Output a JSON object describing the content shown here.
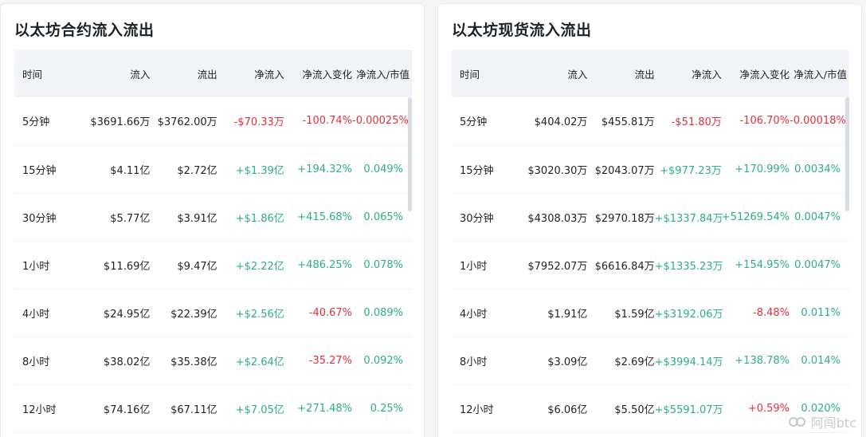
{
  "left_panel": {
    "title": "以太坊合约流入流出",
    "headers": [
      "时间",
      "流入",
      "流出",
      "净流入",
      "净流入变化",
      "净流入/市值"
    ],
    "rows": [
      {
        "time": "5分钟",
        "inflow": "$3691.66万",
        "outflow": "$3762.00万",
        "net": "-$70.33万",
        "change": "-100.74%",
        "ratio": "-0.00025%",
        "net_dir": "neg",
        "change_dir": "neg",
        "ratio_dir": "neg"
      },
      {
        "time": "15分钟",
        "inflow": "$4.11亿",
        "outflow": "$2.72亿",
        "net": "+$1.39亿",
        "change": "+194.32%",
        "ratio": "0.049%",
        "net_dir": "pos",
        "change_dir": "pos",
        "ratio_dir": "pos"
      },
      {
        "time": "30分钟",
        "inflow": "$5.77亿",
        "outflow": "$3.91亿",
        "net": "+$1.86亿",
        "change": "+415.68%",
        "ratio": "0.065%",
        "net_dir": "pos",
        "change_dir": "pos",
        "ratio_dir": "pos"
      },
      {
        "time": "1小时",
        "inflow": "$11.69亿",
        "outflow": "$9.47亿",
        "net": "+$2.22亿",
        "change": "+486.25%",
        "ratio": "0.078%",
        "net_dir": "pos",
        "change_dir": "pos",
        "ratio_dir": "pos"
      },
      {
        "time": "4小时",
        "inflow": "$24.95亿",
        "outflow": "$22.39亿",
        "net": "+$2.56亿",
        "change": "-40.67%",
        "ratio": "0.089%",
        "net_dir": "pos",
        "change_dir": "neg",
        "ratio_dir": "pos"
      },
      {
        "time": "8小时",
        "inflow": "$38.02亿",
        "outflow": "$35.38亿",
        "net": "+$2.64亿",
        "change": "-35.27%",
        "ratio": "0.092%",
        "net_dir": "pos",
        "change_dir": "neg",
        "ratio_dir": "pos"
      },
      {
        "time": "12小时",
        "inflow": "$74.16亿",
        "outflow": "$67.11亿",
        "net": "+$7.05亿",
        "change": "+271.48%",
        "ratio": "0.25%",
        "net_dir": "pos",
        "change_dir": "pos",
        "ratio_dir": "pos"
      }
    ]
  },
  "right_panel": {
    "title": "以太坊现货流入流出",
    "headers": [
      "时间",
      "流入",
      "流出",
      "净流入",
      "净流入变化",
      "净流入/市值"
    ],
    "rows": [
      {
        "time": "5分钟",
        "inflow": "$404.02万",
        "outflow": "$455.81万",
        "net": "-$51.80万",
        "change": "-106.70%",
        "ratio": "-0.00018%",
        "net_dir": "neg",
        "change_dir": "neg",
        "ratio_dir": "neg"
      },
      {
        "time": "15分钟",
        "inflow": "$3020.30万",
        "outflow": "$2043.07万",
        "net": "+$977.23万",
        "change": "+170.99%",
        "ratio": "0.0034%",
        "net_dir": "pos",
        "change_dir": "pos",
        "ratio_dir": "pos"
      },
      {
        "time": "30分钟",
        "inflow": "$4308.03万",
        "outflow": "$2970.18万",
        "net": "+$1337.84万",
        "change": "+51269.54%",
        "ratio": "0.0047%",
        "net_dir": "pos",
        "change_dir": "pos",
        "ratio_dir": "pos"
      },
      {
        "time": "1小时",
        "inflow": "$7952.07万",
        "outflow": "$6616.84万",
        "net": "+$1335.23万",
        "change": "+154.95%",
        "ratio": "0.0047%",
        "net_dir": "pos",
        "change_dir": "pos",
        "ratio_dir": "pos"
      },
      {
        "time": "4小时",
        "inflow": "$1.91亿",
        "outflow": "$1.59亿",
        "net": "+$3192.06万",
        "change": "-8.48%",
        "ratio": "0.011%",
        "net_dir": "pos",
        "change_dir": "neg",
        "ratio_dir": "pos"
      },
      {
        "time": "8小时",
        "inflow": "$3.09亿",
        "outflow": "$2.69亿",
        "net": "+$3994.14万",
        "change": "+138.78%",
        "ratio": "0.014%",
        "net_dir": "pos",
        "change_dir": "pos",
        "ratio_dir": "pos"
      },
      {
        "time": "12小时",
        "inflow": "$6.06亿",
        "outflow": "$5.50亿",
        "net": "+$5591.07万",
        "change": "+0.59%",
        "ratio": "0.020%",
        "net_dir": "pos",
        "change_dir": "neg",
        "ratio_dir": "pos"
      }
    ]
  },
  "watermark": {
    "text": "阿闯btc",
    "icon": "link-logo-icon"
  },
  "colors": {
    "positive": "#2ead87",
    "negative": "#e0303e",
    "header_bg": "#f1f3f6"
  }
}
